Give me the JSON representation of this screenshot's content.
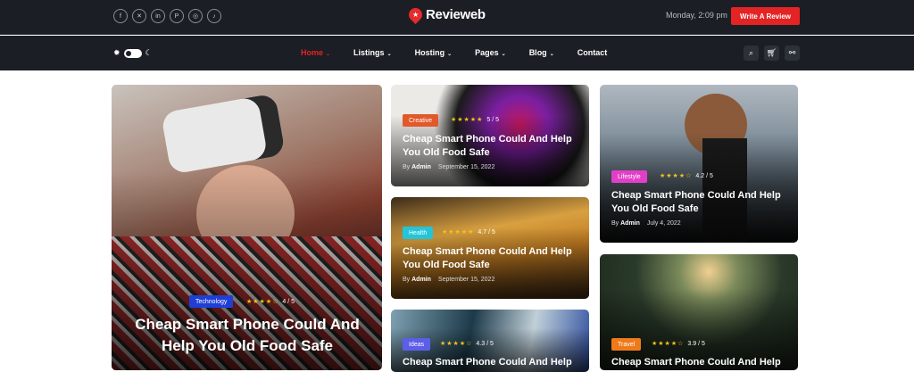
{
  "header": {
    "social_icons": [
      "facebook-icon",
      "twitter-x-icon",
      "linkedin-icon",
      "pinterest-icon",
      "instagram-icon",
      "tiktok-icon"
    ],
    "logo_text": "Revieweb",
    "datetime": "Monday, 2:09 pm",
    "cta_label": "Write A Review"
  },
  "nav": {
    "items": [
      {
        "label": "Home",
        "active": true
      },
      {
        "label": "Listings"
      },
      {
        "label": "Hosting"
      },
      {
        "label": "Pages"
      },
      {
        "label": "Blog"
      },
      {
        "label": "Contact"
      }
    ]
  },
  "colors": {
    "accent": "#e42424",
    "dark": "#1b1e24"
  },
  "cards": {
    "featured": {
      "category": "Technology",
      "color": "#1f3fd6",
      "rating": "4 / 5",
      "stars": "★★★★☆",
      "title_l1": "Cheap Smart Phone Could And",
      "title_l2": "Help You Old Food Safe"
    },
    "c1": {
      "category": "Creative",
      "color": "#e2582a",
      "rating": "5 / 5",
      "stars": "★★★★★",
      "title_l1": "Cheap Smart Phone Could And Help",
      "title_l2": "You Old Food Safe",
      "by": "By",
      "author": "Admin",
      "date": "September 15, 2022"
    },
    "c2": {
      "category": "Health",
      "color": "#23c5d8",
      "rating": "4.7 / 5",
      "stars": "★★★★★",
      "title_l1": "Cheap Smart Phone Could And Help",
      "title_l2": "You Old Food Safe",
      "by": "By",
      "author": "Admin",
      "date": "September 15, 2022"
    },
    "c3": {
      "category": "Ideas",
      "color": "#5b5ee8",
      "rating": "4.3 / 5",
      "stars": "★★★★☆",
      "title_l1": "Cheap Smart Phone Could And Help"
    },
    "c4": {
      "category": "Lifestyle",
      "color": "#e23fc8",
      "rating": "4.2 / 5",
      "stars": "★★★★☆",
      "title_l1": "Cheap Smart Phone Could And Help",
      "title_l2": "You Old Food Safe",
      "by": "By",
      "author": "Admin",
      "date": "July 4, 2022"
    },
    "c5": {
      "category": "Travel",
      "color": "#ef7a1a",
      "rating": "3.9 / 5",
      "stars": "★★★★☆",
      "title_l1": "Cheap Smart Phone Could And Help"
    }
  }
}
